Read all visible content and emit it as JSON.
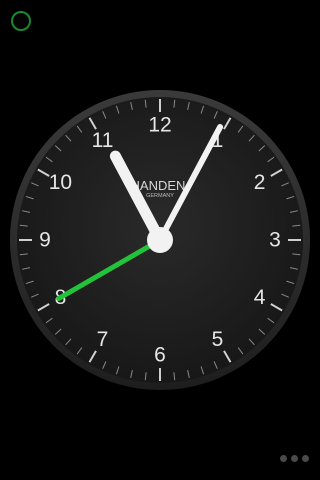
{
  "clock": {
    "brand": "HANDEN",
    "brand_sub": "GERMANY",
    "numerals": [
      "12",
      "1",
      "2",
      "3",
      "4",
      "5",
      "6",
      "7",
      "8",
      "9",
      "10",
      "11"
    ],
    "time": {
      "hour": 11,
      "minute": 4,
      "second": 40
    }
  },
  "colors": {
    "background": "#000000",
    "face": "#1b1b1b",
    "hands": "#f2f2f2",
    "second_hand": "#22c33a",
    "status_ring": "#1a8a2e"
  },
  "pager": {
    "count": 3
  }
}
